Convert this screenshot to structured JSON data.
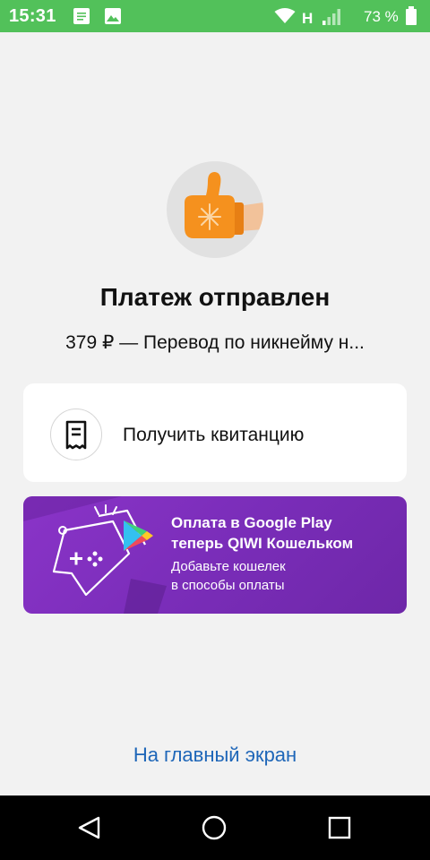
{
  "status_bar": {
    "time": "15:31",
    "network": "H",
    "battery": "73 %",
    "icons": [
      "notes-icon",
      "image-icon",
      "wifi-icon",
      "signal-icon",
      "battery-icon"
    ]
  },
  "payment": {
    "title": "Платеж отправлен",
    "subtitle": "379 ₽ — Перевод по никнейму н...",
    "icon": "mitten-thumbs-up-icon"
  },
  "receipt": {
    "label": "Получить квитанцию",
    "icon": "receipt-icon"
  },
  "promo": {
    "line1": "Оплата в Google Play",
    "line2": "теперь QIWI Кошельком",
    "line3": "Добавьте кошелек",
    "line4": "в способы оплаты",
    "icon": "google-play-icon"
  },
  "home_link": "На главный экран",
  "colors": {
    "status_bar": "#52c15a",
    "link": "#1e66b8",
    "promo_bg": "#7a2db9",
    "mitten": "#f5911e"
  },
  "nav": [
    "back-icon",
    "home-icon",
    "recents-icon"
  ]
}
